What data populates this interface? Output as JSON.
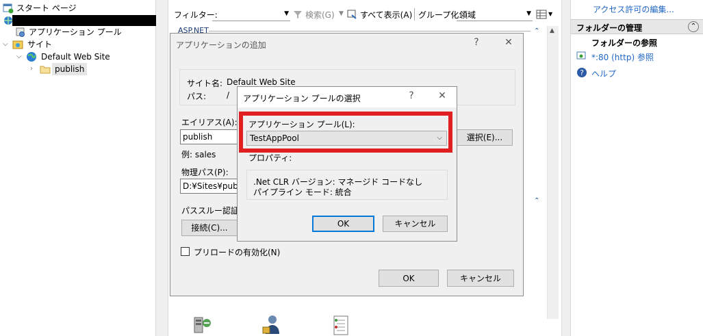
{
  "tree": {
    "start_page": "スタート ページ",
    "app_pools": "アプリケーション プール",
    "sites": "サイト",
    "default_site": "Default Web Site",
    "publish": "publish"
  },
  "filterbar": {
    "filter_label": "フィルター:",
    "search_label": "検索(G)",
    "show_all_label": "すべて表示(A)",
    "group_label": "グループ化:",
    "group_value": "領域",
    "section_label": "ASP.NET"
  },
  "actions": {
    "access_link": "アクセス許可の編集...",
    "folder_manage_header": "フォルダーの管理",
    "browse_folder_title": "フォルダーの参照",
    "browse_link": "*:80 (http) 参照",
    "help_link": "ヘルプ"
  },
  "add_app_dialog": {
    "title": "アプリケーションの追加",
    "help_glyph": "?",
    "close_glyph": "✕",
    "site_name_label": "サイト名:",
    "site_name_value": "Default Web Site",
    "path_label": "パス:",
    "path_value": "/",
    "alias_label": "エイリアス(A):",
    "alias_value": "publish",
    "alias_example": "例: sales",
    "physical_path_label": "物理パス(P):",
    "physical_path_value": "D:¥Sites¥publish",
    "select_button": "選択(E)...",
    "passthrough_label": "パススルー認証",
    "connect_button": "接続(C)...",
    "preload_label": "プリロードの有効化(N)",
    "ok_button": "OK",
    "cancel_button": "キャンセル"
  },
  "pool_dialog": {
    "title": "アプリケーション プールの選択",
    "help_glyph": "?",
    "close_glyph": "✕",
    "pool_label": "アプリケーション プール(L):",
    "pool_value": "TestAppPool",
    "properties_label": "プロパティ:",
    "clr_line": ".Net CLR バージョン: マネージド コードなし",
    "pipeline_line": "パイプライン モード: 統合",
    "ok_button": "OK",
    "cancel_button": "キャンセル"
  },
  "colors": {
    "highlight_red": "#e02020",
    "link_blue": "#1e66c4",
    "default_button_border": "#0078d7"
  }
}
